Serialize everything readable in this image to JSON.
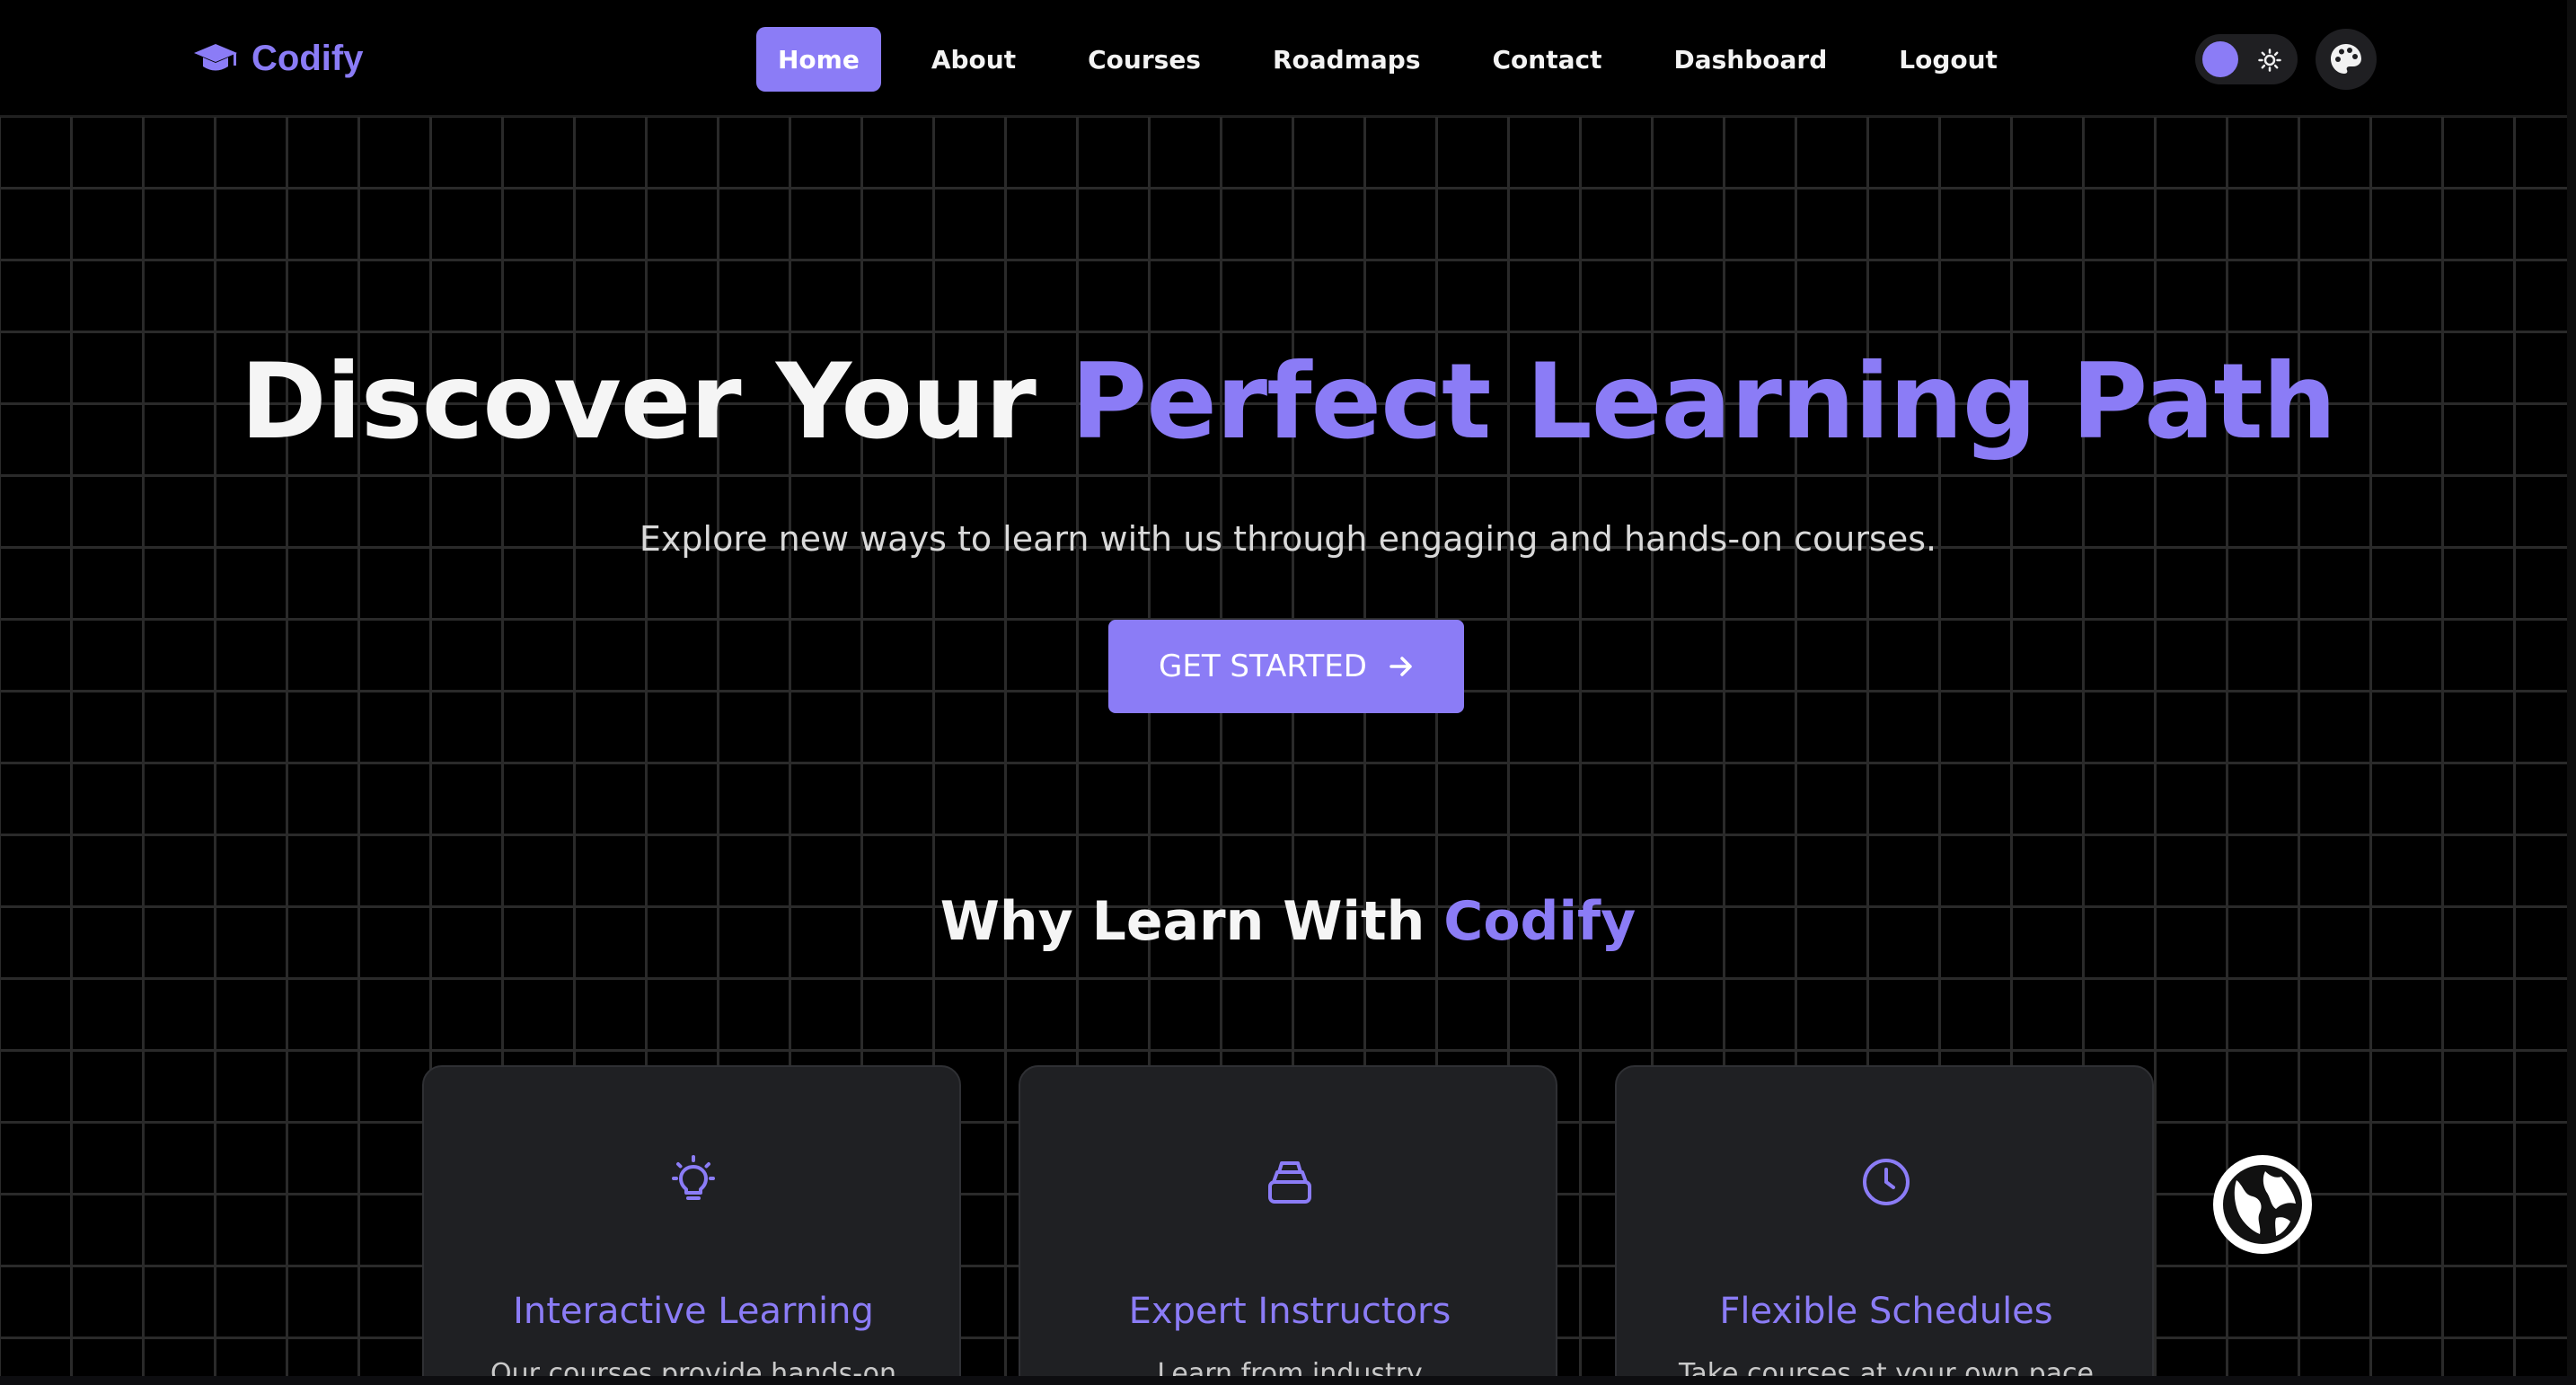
{
  "brand": {
    "name": "Codify",
    "icon": "graduation-cap-icon"
  },
  "nav": {
    "items": [
      {
        "label": "Home",
        "active": true
      },
      {
        "label": "About",
        "active": false
      },
      {
        "label": "Courses",
        "active": false
      },
      {
        "label": "Roadmaps",
        "active": false
      },
      {
        "label": "Contact",
        "active": false
      },
      {
        "label": "Dashboard",
        "active": false
      },
      {
        "label": "Logout",
        "active": false
      }
    ]
  },
  "controls": {
    "theme_toggle_icon": "sun-icon",
    "palette_icon": "palette-icon",
    "language_icon": "globe-icon"
  },
  "hero": {
    "title_prefix": "Discover Your ",
    "title_accent": "Perfect Learning Path",
    "subtitle": "Explore new ways to learn with us through engaging and hands-on courses.",
    "cta_label": "GET STARTED"
  },
  "why": {
    "title_prefix": "Why Learn With ",
    "title_accent": "Codify"
  },
  "features": [
    {
      "icon": "lightbulb-icon",
      "title": "Interactive Learning",
      "desc": "Our courses provide hands-on"
    },
    {
      "icon": "instructor-icon",
      "title": "Expert Instructors",
      "desc": "Learn from industry"
    },
    {
      "icon": "clock-icon",
      "title": "Flexible Schedules",
      "desc": "Take courses at your own pace"
    }
  ],
  "colors": {
    "accent": "#8b7cf6",
    "background": "#000000",
    "card": "#1f2023"
  }
}
